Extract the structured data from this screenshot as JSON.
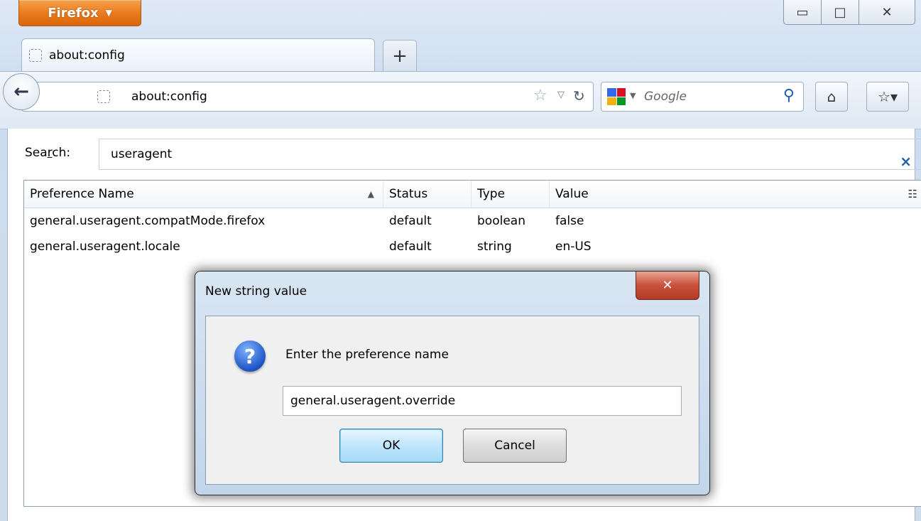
{
  "window": {
    "app_button": "Firefox",
    "minimize_glyph": "▭",
    "maximize_glyph": "□",
    "close_glyph": "✕"
  },
  "tabs": {
    "active_tab_title": "about:config",
    "new_tab_glyph": "+"
  },
  "navbar": {
    "back_glyph": "←",
    "url": "about:config",
    "search_engine": "Google",
    "home_glyph": "⌂",
    "bookmarks_glyph": "☆▾"
  },
  "filter": {
    "label_prefix": "Sea",
    "label_access": "r",
    "label_suffix": "ch:",
    "value": "useragent",
    "clear_glyph": "×"
  },
  "table": {
    "columns": [
      "Preference Name",
      "Status",
      "Type",
      "Value"
    ],
    "rows": [
      {
        "name": "general.useragent.compatMode.firefox",
        "status": "default",
        "type": "boolean",
        "value": "false"
      },
      {
        "name": "general.useragent.locale",
        "status": "default",
        "type": "string",
        "value": "en-US"
      }
    ]
  },
  "dialog": {
    "title": "New string value",
    "close_glyph": "✕",
    "question_glyph": "?",
    "prompt": "Enter the preference name",
    "input_value": "general.useragent.override",
    "ok_label": "OK",
    "cancel_label": "Cancel"
  },
  "icons": {
    "sort": "sort-ascending-icon",
    "column_picker": "column-picker-icon"
  },
  "colors": {
    "firefox_orange": "#e8791c",
    "close_red": "#c9503a",
    "accent_blue": "#1f5fa8"
  }
}
